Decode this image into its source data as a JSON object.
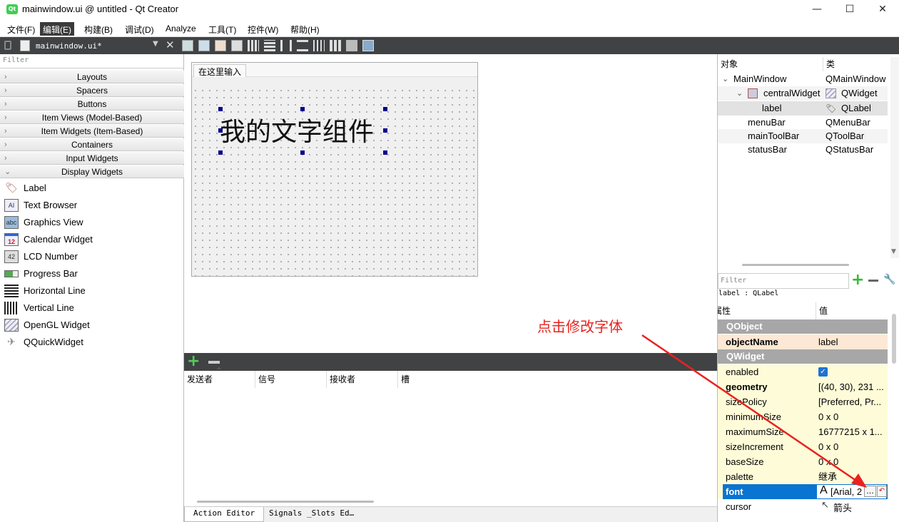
{
  "window": {
    "title": "mainwindow.ui @ untitled - Qt Creator",
    "minimize": "—",
    "maximize": "☐",
    "close": "✕"
  },
  "menu": [
    "文件(F)",
    "编辑(E)",
    "构建(B)",
    "调试(D)",
    "Analyze",
    "工具(T)",
    "控件(W)",
    "帮助(H)"
  ],
  "editor": {
    "file_tab": "mainwindow.ui*"
  },
  "widgetbox": {
    "filter_placeholder": "Filter",
    "categories": [
      "Layouts",
      "Spacers",
      "Buttons",
      "Item Views (Model-Based)",
      "Item Widgets (Item-Based)",
      "Containers",
      "Input Widgets",
      "Display Widgets"
    ],
    "display_widgets": [
      {
        "label": "Label",
        "icon": "label-tag-icon"
      },
      {
        "label": "Text Browser",
        "icon": "text-browser-icon"
      },
      {
        "label": "Graphics View",
        "icon": "graphics-view-icon"
      },
      {
        "label": "Calendar Widget",
        "icon": "calendar-icon"
      },
      {
        "label": "LCD Number",
        "icon": "lcd-number-icon"
      },
      {
        "label": "Progress Bar",
        "icon": "progress-bar-icon"
      },
      {
        "label": "Horizontal Line",
        "icon": "horizontal-line-icon"
      },
      {
        "label": "Vertical Line",
        "icon": "vertical-line-icon"
      },
      {
        "label": "OpenGL Widget",
        "icon": "opengl-widget-icon"
      },
      {
        "label": "QQuickWidget",
        "icon": "quick-widget-icon"
      }
    ]
  },
  "form": {
    "menu_placeholder": "在这里输入",
    "label_text": "我的文字组件"
  },
  "signals": {
    "columns": [
      "发送者",
      "信号",
      "接收者",
      "槽"
    ]
  },
  "bottom_tabs": [
    "Action Editor",
    "Signals _Slots Ed…"
  ],
  "object_inspector": {
    "headers": [
      "对象",
      "类"
    ],
    "rows": [
      {
        "name": "MainWindow",
        "class": "QMainWindow"
      },
      {
        "name": "centralWidget",
        "class": "QWidget"
      },
      {
        "name": "label",
        "class": "QLabel"
      },
      {
        "name": "menuBar",
        "class": "QMenuBar"
      },
      {
        "name": "mainToolBar",
        "class": "QToolBar"
      },
      {
        "name": "statusBar",
        "class": "QStatusBar"
      }
    ]
  },
  "property_editor": {
    "filter_placeholder": "Filter",
    "object_caption": "label : QLabel",
    "headers": [
      "属性",
      "值"
    ],
    "sections": {
      "qobject": "QObject",
      "qwidget": "QWidget"
    },
    "rows": [
      {
        "name": "objectName",
        "value": "label"
      },
      {
        "name": "enabled",
        "value": "✓"
      },
      {
        "name": "geometry",
        "value": "[(40, 30), 231 ..."
      },
      {
        "name": "sizePolicy",
        "value": "[Preferred, Pr..."
      },
      {
        "name": "minimumSize",
        "value": "0 x 0"
      },
      {
        "name": "maximumSize",
        "value": "16777215 x 1..."
      },
      {
        "name": "sizeIncrement",
        "value": "0 x 0"
      },
      {
        "name": "baseSize",
        "value": "0 x 0"
      },
      {
        "name": "palette",
        "value": "继承"
      },
      {
        "name": "font",
        "value": "[Arial, 2"
      },
      {
        "name": "cursor",
        "value": "箭头"
      }
    ]
  },
  "annotation": {
    "text": "点击修改字体",
    "color": "#e8231f"
  }
}
